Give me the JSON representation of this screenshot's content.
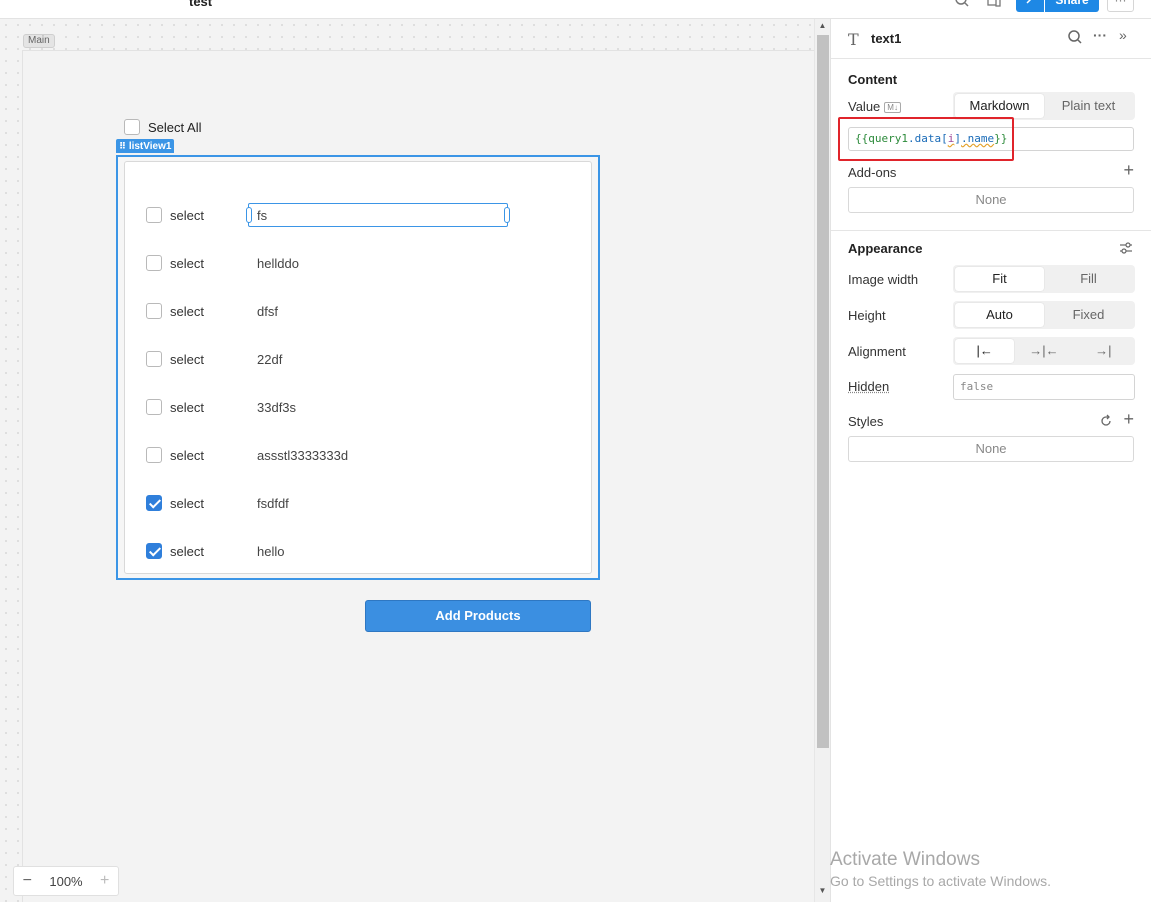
{
  "topbar": {
    "app_title": "test",
    "share_label": "Share",
    "link_icon": "link-icon",
    "more_label": "···"
  },
  "canvas": {
    "frame_label": "Main",
    "select_all_label": "Select All",
    "listview_tag": "listView1",
    "rows": [
      {
        "select_label": "select",
        "name": "fs",
        "checked": false,
        "selected": true
      },
      {
        "select_label": "select",
        "name": "hellddo",
        "checked": false,
        "selected": false
      },
      {
        "select_label": "select",
        "name": "dfsf",
        "checked": false,
        "selected": false
      },
      {
        "select_label": "select",
        "name": "22df",
        "checked": false,
        "selected": false
      },
      {
        "select_label": "select",
        "name": "33df3s",
        "checked": false,
        "selected": false
      },
      {
        "select_label": "select",
        "name": "assstl3333333d",
        "checked": false,
        "selected": false
      },
      {
        "select_label": "select",
        "name": "fsdfdf",
        "checked": true,
        "selected": false
      },
      {
        "select_label": "select",
        "name": "hello",
        "checked": true,
        "selected": false
      }
    ],
    "add_button_label": "Add Products",
    "zoom_value": "100%"
  },
  "panel": {
    "component_name": "text1",
    "content_title": "Content",
    "value_label": "Value",
    "markdown_badge": "M↓",
    "format_options": [
      "Markdown",
      "Plain text"
    ],
    "format_selected": "Markdown",
    "value_code": {
      "open": "{{",
      "obj": "query1",
      "p1": ".data[",
      "idx": "i",
      "p2": "]",
      "key": ".name",
      "close": "}}"
    },
    "addons_label": "Add-ons",
    "addons_value": "None",
    "appearance_title": "Appearance",
    "image_width_label": "Image width",
    "image_width_options": [
      "Fit",
      "Fill"
    ],
    "height_label": "Height",
    "height_options": [
      "Auto",
      "Fixed"
    ],
    "alignment_label": "Alignment",
    "alignment_icons": [
      "align-left-icon",
      "align-center-icon",
      "align-right-icon"
    ],
    "hidden_label": "Hidden",
    "hidden_value": "false",
    "styles_label": "Styles",
    "styles_value": "None"
  },
  "watermark": {
    "line1": "Activate Windows",
    "line2": "Go to Settings to activate Windows."
  },
  "colors": {
    "accent": "#3b95e6",
    "button": "#3b8fe1",
    "highlight": "#e0242b",
    "check": "#2f7fdb"
  }
}
